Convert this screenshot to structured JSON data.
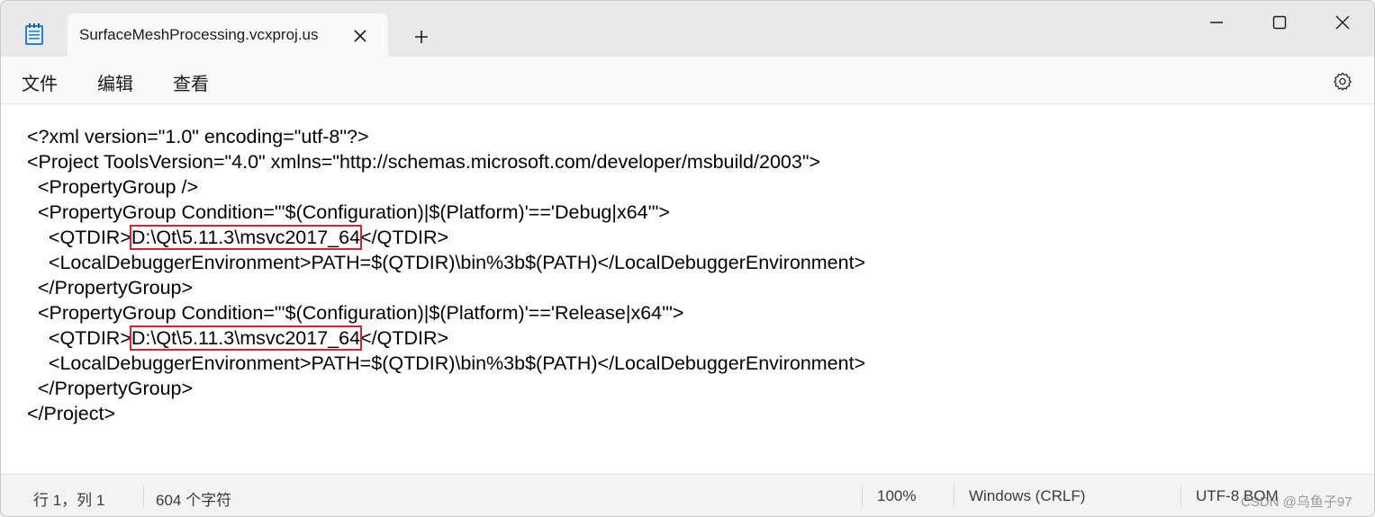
{
  "tab": {
    "title": "SurfaceMeshProcessing.vcxproj.us",
    "close_glyph": "✕"
  },
  "titlebar": {
    "new_tab_glyph": "+"
  },
  "menu": {
    "items": [
      "文件",
      "编辑",
      "查看"
    ]
  },
  "editor": {
    "lines": [
      "<?xml version=\"1.0\" encoding=\"utf-8\"?>",
      "<Project ToolsVersion=\"4.0\" xmlns=\"http://schemas.microsoft.com/developer/msbuild/2003\">",
      "  <PropertyGroup />",
      "  <PropertyGroup Condition=\"'$(Configuration)|$(Platform)'=='Debug|x64'\">",
      {
        "pre": "    <QTDIR>",
        "highlight": "D:\\Qt\\5.11.3\\msvc2017_64",
        "post": "</QTDIR>"
      },
      "    <LocalDebuggerEnvironment>PATH=$(QTDIR)\\bin%3b$(PATH)</LocalDebuggerEnvironment>",
      "  </PropertyGroup>",
      "  <PropertyGroup Condition=\"'$(Configuration)|$(Platform)'=='Release|x64'\">",
      {
        "pre": "    <QTDIR>",
        "highlight": "D:\\Qt\\5.11.3\\msvc2017_64",
        "post": "</QTDIR>"
      },
      "    <LocalDebuggerEnvironment>PATH=$(QTDIR)\\bin%3b$(PATH)</LocalDebuggerEnvironment>",
      "  </PropertyGroup>",
      "</Project>"
    ]
  },
  "status": {
    "position": "行 1，列 1",
    "char_count": "604 个字符",
    "zoom": "100%",
    "line_ending": "Windows (CRLF)",
    "encoding": "UTF-8 BOM"
  },
  "watermark": "CSDN @乌鱼子97",
  "colors": {
    "highlight_box": "#d9232e",
    "titlebar": "#e9e9e9",
    "editor_bg": "#ffffff"
  }
}
